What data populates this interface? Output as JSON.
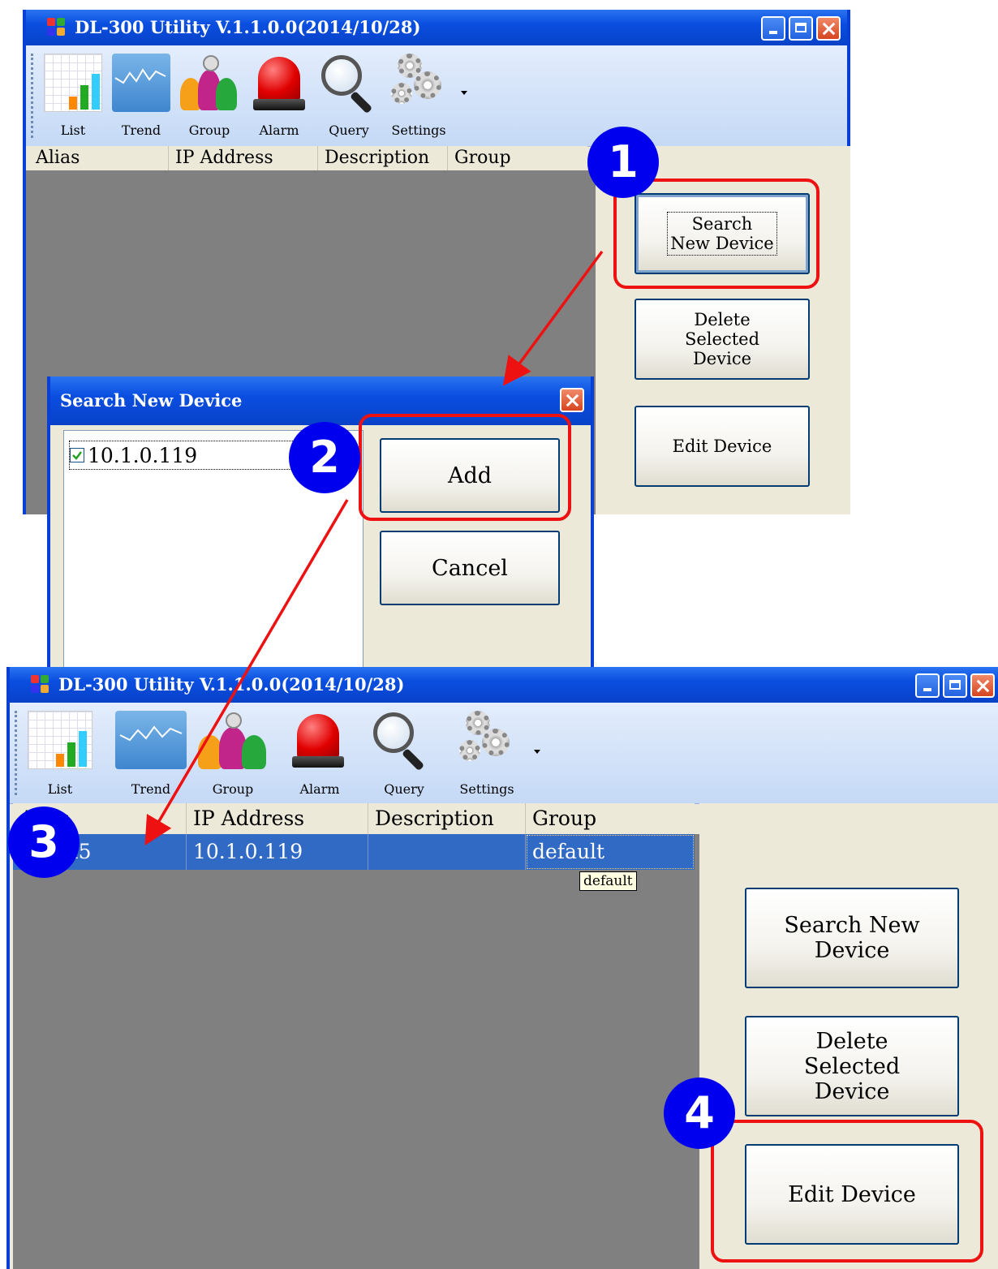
{
  "window1": {
    "title": "DL-300 Utility V.1.1.0.0(2014/10/28)",
    "toolbar": [
      {
        "label": "List",
        "icon": "list-icon"
      },
      {
        "label": "Trend",
        "icon": "trend-icon"
      },
      {
        "label": "Group",
        "icon": "group-icon"
      },
      {
        "label": "Alarm",
        "icon": "alarm-icon"
      },
      {
        "label": "Query",
        "icon": "query-icon"
      },
      {
        "label": "Settings",
        "icon": "settings-icon"
      }
    ],
    "columns": [
      "Alias",
      "IP Address",
      "Description",
      "Group"
    ],
    "buttons": {
      "search": "Search New Device",
      "delete": "Delete Selected Device",
      "edit": "Edit Device"
    }
  },
  "dialog": {
    "title": "Search New Device",
    "device_item": "10.1.0.119",
    "device_checked": true,
    "add": "Add",
    "cancel": "Cancel"
  },
  "window2": {
    "title": "DL-300 Utility V.1.1.0.0(2014/10/28)",
    "toolbar": [
      {
        "label": "List",
        "icon": "list-icon"
      },
      {
        "label": "Trend",
        "icon": "trend-icon"
      },
      {
        "label": "Group",
        "icon": "group-icon"
      },
      {
        "label": "Alarm",
        "icon": "alarm-icon"
      },
      {
        "label": "Query",
        "icon": "query-icon"
      },
      {
        "label": "Settings",
        "icon": "settings-icon"
      }
    ],
    "columns": [
      "Alias",
      "IP Address",
      "Description",
      "Group"
    ],
    "rows": [
      {
        "alias": "Room5",
        "ip": "10.1.0.119",
        "description": "",
        "group": "default"
      }
    ],
    "tooltip": "default",
    "buttons": {
      "search": "Search New Device",
      "delete": "Delete Selected Device",
      "edit": "Edit Device"
    }
  },
  "steps": [
    "1",
    "2",
    "3",
    "4"
  ],
  "colors": {
    "title_blue": "#0a4ee0",
    "selection": "#316ac5",
    "highlight_red": "#ee1111",
    "badge_blue": "#0000ee",
    "list_bg": "#808080"
  }
}
